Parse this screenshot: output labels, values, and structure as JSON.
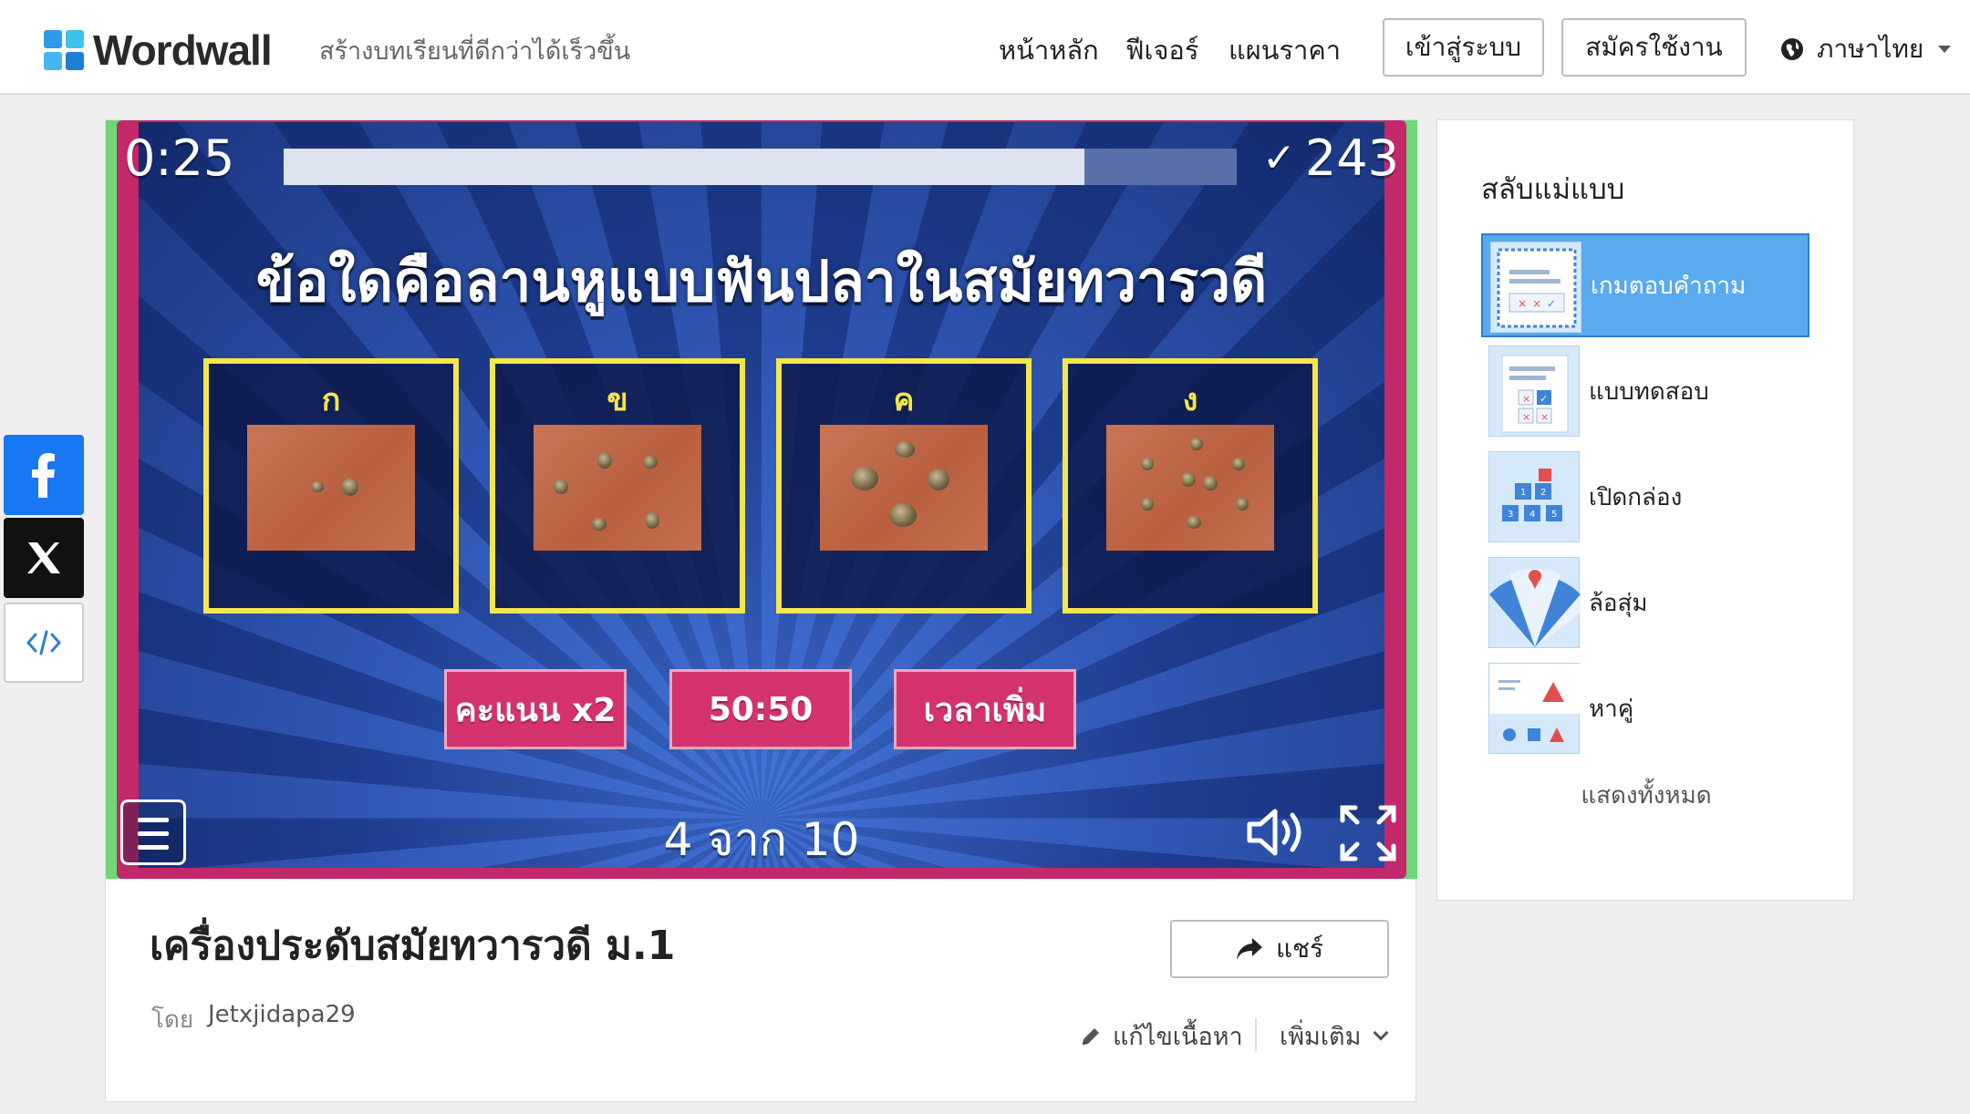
{
  "header": {
    "logo_text": "Wordwall",
    "tagline": "สร้างบทเรียนที่ดีกว่าได้เร็วขึ้น",
    "nav": [
      "หน้าหลัก",
      "ฟีเจอร์",
      "แผนราคา"
    ],
    "login_label": "เข้าสู่ระบบ",
    "signup_label": "สมัครใช้งาน",
    "language_label": "ภาษาไทย"
  },
  "colors": {
    "logo_tiles": [
      "#2f9be8",
      "#3cc2e6",
      "#45b6f3",
      "#1d7fd6"
    ],
    "facebook": "#1877f2",
    "selected_template": "#5aaaf0",
    "answer_border": "#f5e64c",
    "lifeline": "#d4326e",
    "frame_pink": "#c2286a",
    "frame_green": "#6fd67a"
  },
  "share_rail": {
    "icons": [
      "facebook-icon",
      "x-icon",
      "embed-code-icon"
    ]
  },
  "game": {
    "timer": "0:25",
    "time_remaining_fraction": 0.84,
    "score": "243",
    "question": "ข้อใดคือลานหูแบบฟันปลาในสมัยทวารวดี",
    "answers": [
      {
        "letter": "ก"
      },
      {
        "letter": "ข"
      },
      {
        "letter": "ค"
      },
      {
        "letter": "ง"
      }
    ],
    "lifelines": [
      "คะแนน x2",
      "50:50",
      "เวลาเพิ่ม"
    ],
    "counter": "4 จาก 10"
  },
  "activity": {
    "title": "เครื่องประดับสมัยทวารวดี ม.1",
    "by_label": "โดย",
    "author": "Jetxjidapa29",
    "share_label": "แชร์",
    "edit_label": "แก้ไขเนื้อหา",
    "more_label": "เพิ่มเติม"
  },
  "templates": {
    "title": "สลับแม่แบบ",
    "items": [
      {
        "label": "เกมตอบคำถาม",
        "icon": "quiz-game-thumb",
        "selected": true
      },
      {
        "label": "แบบทดสอบ",
        "icon": "quiz-thumb",
        "selected": false
      },
      {
        "label": "เปิดกล่อง",
        "icon": "open-box-thumb",
        "selected": false
      },
      {
        "label": "ล้อสุ่ม",
        "icon": "random-wheel-thumb",
        "selected": false
      },
      {
        "label": "หาคู่",
        "icon": "match-up-thumb",
        "selected": false
      }
    ],
    "show_all_label": "แสดงทั้งหมด"
  }
}
